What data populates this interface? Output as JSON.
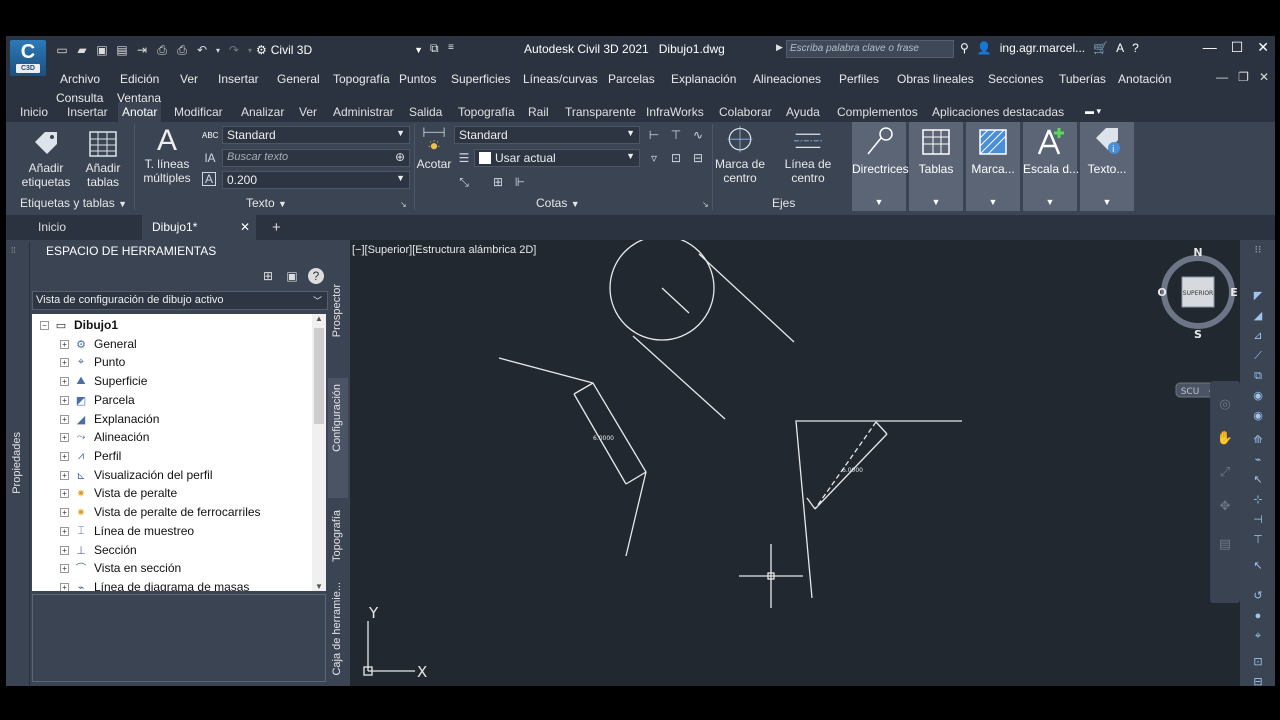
{
  "app": {
    "title": "Autodesk Civil 3D 2021",
    "document": "Dibujo1.dwg",
    "logo_text": "C3D",
    "workspace": "Civil 3D",
    "search_placeholder": "Escriba palabra clave o frase",
    "user": "ing.agr.marcel..."
  },
  "menubar": {
    "items": [
      "Archivo",
      "Edición",
      "Ver",
      "Insertar",
      "General",
      "Topografía",
      "Puntos",
      "Superficies",
      "Líneas/curvas",
      "Parcelas",
      "Explanación",
      "Alineaciones",
      "Perfiles",
      "Obras lineales",
      "Secciones",
      "Tuberías",
      "Anotación",
      "Consulta",
      "Ventana"
    ]
  },
  "ribbon_tabs": {
    "items": [
      "Inicio",
      "Insertar",
      "Anotar",
      "Modificar",
      "Analizar",
      "Ver",
      "Administrar",
      "Salida",
      "Topografía",
      "Rail",
      "Transparente",
      "InfraWorks",
      "Colaborar",
      "Ayuda",
      "Complementos",
      "Aplicaciones destacadas"
    ],
    "active": "Anotar"
  },
  "ribbon": {
    "labels_tables": {
      "add_labels": "Añadir etiquetas",
      "add_tables": "Añadir tablas",
      "panel": "Etiquetas y tablas"
    },
    "text": {
      "mtext": "T. líneas múltiples",
      "mtext_letter": "A",
      "style": "Standard",
      "search_placeholder": "Buscar texto",
      "height": "0.200",
      "panel": "Texto"
    },
    "dims": {
      "dimension": "Acotar",
      "style": "Standard",
      "layer": "Usar actual",
      "panel": "Cotas"
    },
    "axes": {
      "center_mark": "Marca de centro",
      "centerline": "Línea de centro",
      "panel": "Ejes"
    },
    "grey_panels": [
      "Directrices",
      "Tablas",
      "Marca...",
      "Escala d...",
      "Texto..."
    ]
  },
  "doc_tabs": {
    "items": [
      "Inicio",
      "Dibujo1*"
    ],
    "add": "+"
  },
  "palette": {
    "strip_label": "Propiedades",
    "title": "ESPACIO DE HERRAMIENTAS",
    "view": "Vista de configuración de dibujo activo",
    "tree_root": "Dibujo1",
    "tree_items": [
      "General",
      "Punto",
      "Superficie",
      "Parcela",
      "Explanación",
      "Alineación",
      "Perfil",
      "Visualización del perfil",
      "Vista de peralte",
      "Vista de peralte de ferrocarriles",
      "Línea de muestreo",
      "Sección",
      "Vista en sección",
      "Línea de diagrama de masas"
    ],
    "side_tabs": [
      "Prospector",
      "Configuración",
      "Topografía",
      "Caja de herramie..."
    ]
  },
  "viewport": {
    "label": "[−][Superior][Estructura alámbrica 2D]",
    "viewcube": {
      "n": "N",
      "s": "S",
      "e": "E",
      "w": "O",
      "face": "SUPERIOR",
      "ucs": "SCU"
    },
    "dim_text_1": "6.0000",
    "dim_text_2": "6.0000",
    "ucs_x": "X",
    "ucs_y": "Y"
  },
  "colors": {
    "chrome": "#3b4453",
    "dark": "#2b3340",
    "canvas": "#212830",
    "tree_bg": "#ffffff"
  }
}
